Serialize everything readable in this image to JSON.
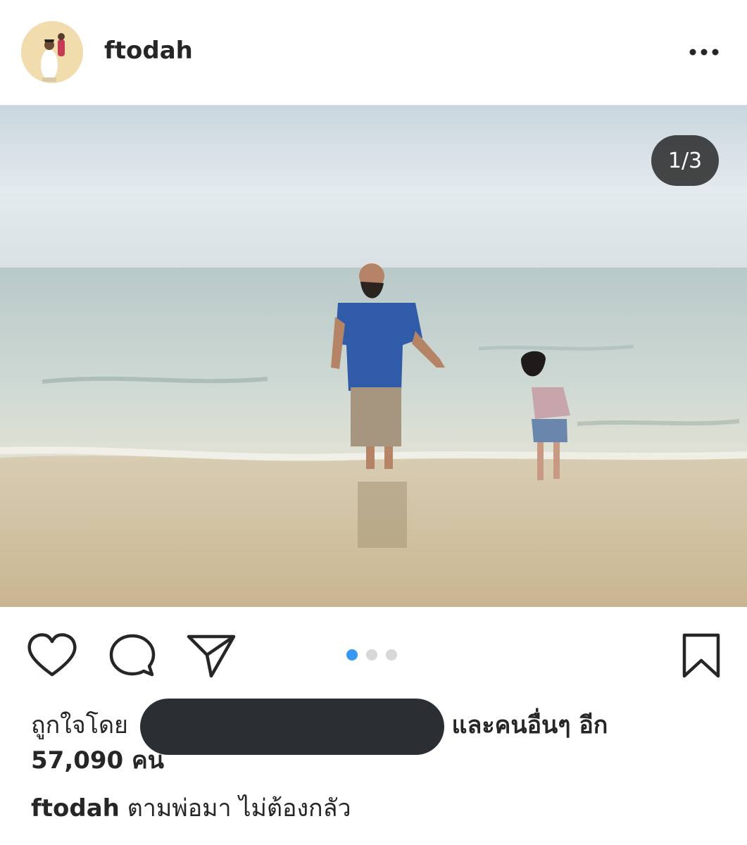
{
  "post": {
    "username": "ftodah",
    "image_counter": "1/3",
    "carousel": {
      "count": 3,
      "active_index": 0
    },
    "likes": {
      "prefix": "ถูกใจโดย",
      "suffix": "และคนอื่นๆ อีก",
      "count_text": "57,090 คน"
    },
    "caption": {
      "username": "ftodah",
      "text": "ตามพ่อมา ไม่ต้องกลัว"
    }
  },
  "icons": {
    "more": "more-horizontal-icon",
    "like": "heart-icon",
    "comment": "comment-bubble-icon",
    "share": "paper-plane-icon",
    "save": "bookmark-icon"
  },
  "colors": {
    "active_dot": "#3897f0",
    "inactive_dot": "#d8d8d8",
    "text": "#262626",
    "redaction": "#2b2e33"
  }
}
